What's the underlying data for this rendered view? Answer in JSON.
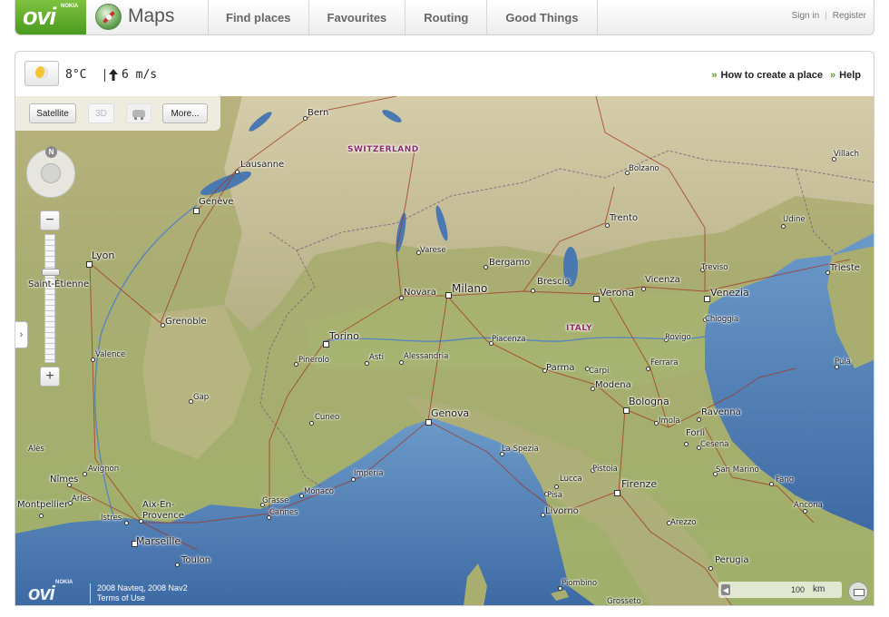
{
  "brand": {
    "ovi": "ovi",
    "nokia": "NOKIA",
    "product": "Maps"
  },
  "nav": {
    "tabs": [
      {
        "label": "Find places"
      },
      {
        "label": "Favourites"
      },
      {
        "label": "Routing"
      },
      {
        "label": "Good Things"
      }
    ],
    "sign_in": "Sign in",
    "register": "Register",
    "separator": "|"
  },
  "toolbar": {
    "temperature": "8°C",
    "wind": "6 m/s",
    "how_to_link": "How to create a place",
    "help_link": "Help"
  },
  "map_controls": {
    "satellite": "Satellite",
    "three_d": "3D",
    "more": "More...",
    "north": "N",
    "zoom_in": "+",
    "zoom_out": "−",
    "expand": "›",
    "zoom_level": 0.28
  },
  "map": {
    "countries": [
      "SWITZERLAND",
      "ITALY"
    ],
    "cities": [
      "Bern",
      "Lausanne",
      "Genève",
      "Lyon",
      "Saint-Étienne",
      "Grenoble",
      "Valence",
      "Gap",
      "Alès",
      "Nîmes",
      "Avignon",
      "Arles",
      "Montpellier",
      "Aix-En-Provence",
      "Istres",
      "Marseille",
      "Toulon",
      "Grasse",
      "Cannes",
      "Monaco",
      "Imperia",
      "Cuneo",
      "Torino",
      "Pinerolo",
      "Asti",
      "Alessandria",
      "Novara",
      "Varese",
      "Milano",
      "Bergamo",
      "Brescia",
      "Verona",
      "Vicenza",
      "Treviso",
      "Venezia",
      "Chioggia",
      "Trieste",
      "Udine",
      "Villach",
      "Bolzano",
      "Trento",
      "Piacenza",
      "Parma",
      "Carpi",
      "Modena",
      "Bologna",
      "Ferrara",
      "Rovigo",
      "Pula",
      "Ravenna",
      "Imola",
      "Forlì",
      "Cesena",
      "San Marino",
      "Fano",
      "Ancona",
      "Genova",
      "La Spezia",
      "Pistoia",
      "Lucca",
      "Pisa",
      "Livorno",
      "Firenze",
      "Arezzo",
      "Perugia",
      "Piombino",
      "Grosseto"
    ]
  },
  "footer": {
    "ovi": "ovi",
    "nokia": "NOKIA",
    "copyright": "2008 Navteq, 2008 Nav2",
    "terms": "Terms of Use",
    "scale_value": "100",
    "scale_unit": "km"
  },
  "colors": {
    "brand_green": "#54a12c",
    "sea": "#4a78b0",
    "land": "#a8b070",
    "country_label": "#8a2a68"
  },
  "icons": [
    "compass-icon",
    "moon-icon",
    "wind-arrow-icon",
    "north-icon",
    "car-icon",
    "print-icon",
    "chevron-right-icon"
  ]
}
